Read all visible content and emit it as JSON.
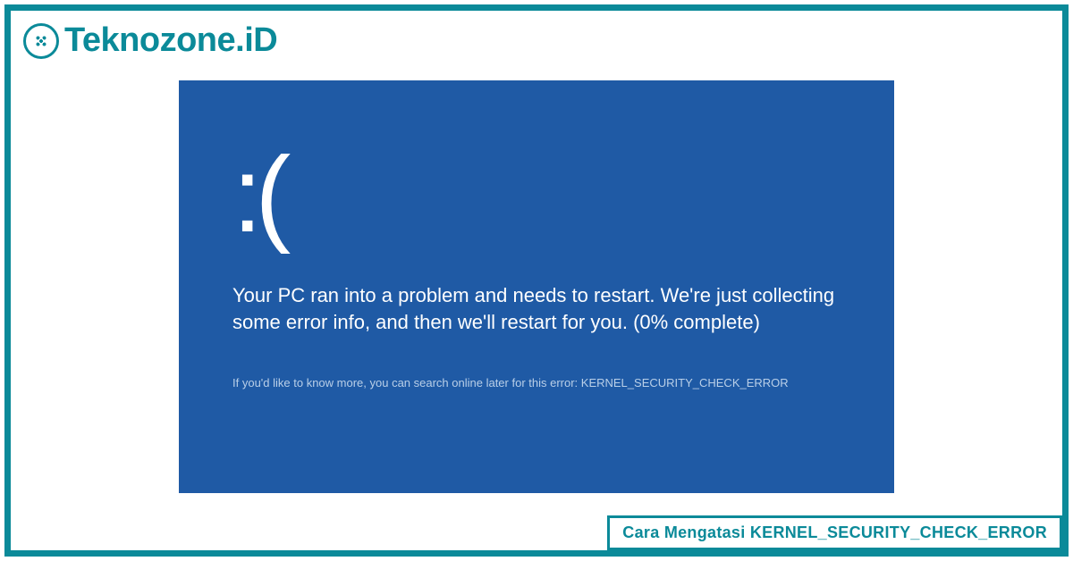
{
  "brand": {
    "name": "Teknozone.iD",
    "icon": "brain-chip-icon",
    "color": "#0b8a99"
  },
  "bsod": {
    "face": ":(",
    "message": "Your PC ran into a problem and needs to restart. We're just collecting some error info, and then we'll restart for you. (0% complete)",
    "hint": "If you'd like to know more, you can search online later for this error: KERNEL_SECURITY_CHECK_ERROR",
    "bg_color": "#1f5aa5"
  },
  "caption": "Cara Mengatasi KERNEL_SECURITY_CHECK_ERROR"
}
